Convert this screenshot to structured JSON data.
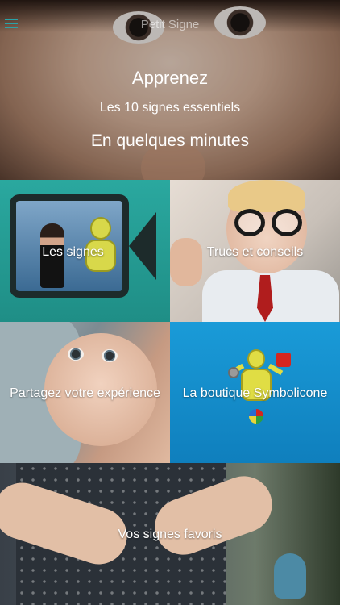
{
  "header": {
    "title": "Petit Signe",
    "menu_icon": "hamburger-menu-icon",
    "menu_color": "#2aa3a8"
  },
  "hero": {
    "line1": "Apprenez",
    "line2": "Les 10 signes essentiels",
    "line3": "En quelques minutes"
  },
  "tiles": [
    {
      "label": "Les signes",
      "icon": "video-camera-icon",
      "background": "#2aa89f"
    },
    {
      "label": "Trucs et conseils"
    },
    {
      "label": "Partagez votre expérience"
    },
    {
      "label": "La boutique Symbolicone",
      "background": "#1a9bd8"
    },
    {
      "label": "Vos signes favoris"
    }
  ]
}
